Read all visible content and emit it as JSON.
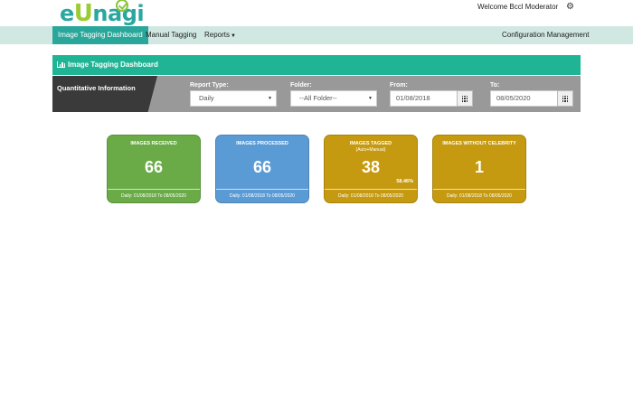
{
  "header": {
    "logo_e": "e",
    "logo_u": "U",
    "logo_rest": "nagi",
    "welcome": "Welcome Bccl Moderator",
    "settings_icon": "gear-icon"
  },
  "nav": {
    "items": [
      {
        "label": "Image Tagging Dashboard",
        "active": true
      },
      {
        "label": "Manual Tagging",
        "active": false
      },
      {
        "label": "Reports",
        "active": false
      }
    ],
    "right_item": "Configuration Management"
  },
  "panel": {
    "title": "Image Tagging Dashboard",
    "title_icon": "bar-chart-icon",
    "section_label": "Quantitative Information"
  },
  "filters": {
    "report_type_label": "Report Type:",
    "report_type_value": "Daily",
    "folder_label": "Folder:",
    "folder_value": "--All Folder--",
    "from_label": "From:",
    "from_value": "01/08/2018",
    "to_label": "To:",
    "to_value": "08/05/2020",
    "calendar_icon": "calendar-icon"
  },
  "cards": [
    {
      "title": "IMAGES RECEIVED",
      "subtitle": "",
      "value": "66",
      "percent": "",
      "footer": "Daily: 01/08/2018 To 08/05/2020",
      "color": "#6aab47"
    },
    {
      "title": "IMAGES PROCESSED",
      "subtitle": "",
      "value": "66",
      "percent": "",
      "footer": "Daily: 01/08/2018 To 08/05/2020",
      "color": "#5b9bd5"
    },
    {
      "title": "IMAGES TAGGED",
      "subtitle": "(Auto+Manual)",
      "value": "38",
      "percent": "58.46%",
      "footer": "Daily: 01/08/2018 To 08/05/2020",
      "color": "#c69a10"
    },
    {
      "title": "IMAGES WITHOUT CELEBRITY",
      "subtitle": "",
      "value": "1",
      "percent": "",
      "footer": "Daily: 01/08/2018 To 08/05/2020",
      "color": "#c69a10"
    }
  ],
  "colors": {
    "brand_teal": "#2aa79b",
    "panel_header": "#1fb594",
    "nav_bg": "#d1e8e2"
  }
}
